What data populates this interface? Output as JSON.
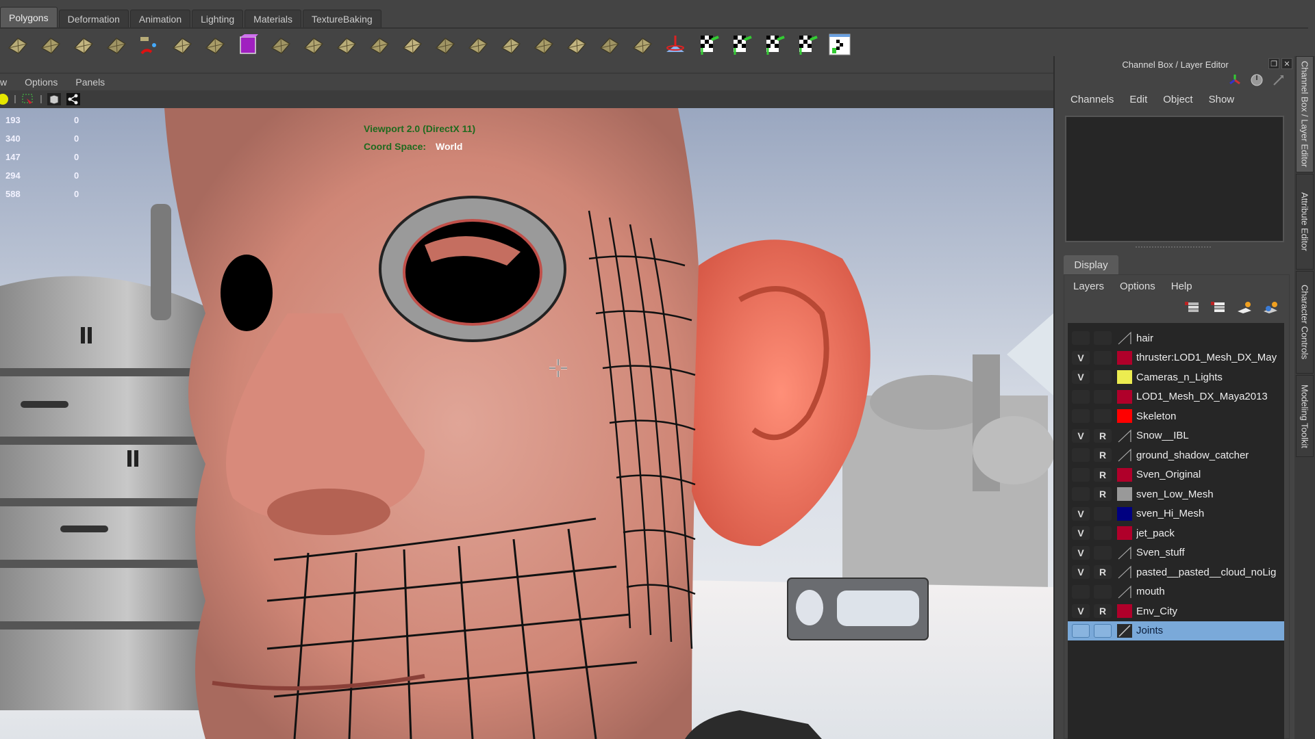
{
  "shelf": {
    "tabs": [
      {
        "label": "Polygons",
        "active": true
      },
      {
        "label": "Deformation",
        "active": false
      },
      {
        "label": "Animation",
        "active": false
      },
      {
        "label": "Lighting",
        "active": false
      },
      {
        "label": "Materials",
        "active": false
      },
      {
        "label": "TextureBaking",
        "active": false
      }
    ],
    "icons": [
      "poly-torus-icon",
      "poly-cone-icon",
      "poly-cylinder-icon",
      "poly-plane-icon",
      "separate-icon",
      "combine-icon",
      "smooth-icon",
      "bevel-cube-icon",
      "extrude-icon",
      "split-poly-icon",
      "bridge-icon",
      "append-icon",
      "fill-hole-icon",
      "duplicate-face-icon",
      "insert-edge-loop-icon",
      "offset-edge-loop-icon",
      "merge-icon",
      "collapse-icon",
      "wedge-icon",
      "poke-icon",
      "sculpt-icon",
      "uv-planar-icon",
      "uv-cylindrical-icon",
      "uv-spherical-icon",
      "uv-automatic-icon",
      "uv-editor-icon"
    ]
  },
  "panel": {
    "menu": [
      "w",
      "Options",
      "Panels"
    ],
    "toolbar_icons": [
      "light-icon",
      "select-camera-icon",
      "cube-icon",
      "share-icon"
    ]
  },
  "viewport": {
    "stats": [
      {
        "value": "193",
        "extra": "0"
      },
      {
        "value": "340",
        "extra": "0"
      },
      {
        "value": "147",
        "extra": "0"
      },
      {
        "value": "294",
        "extra": "0"
      },
      {
        "value": "588",
        "extra": "0"
      }
    ],
    "renderer": "Viewport 2.0 (DirectX 11)",
    "coord_label": "Coord Space:",
    "coord_value": "World"
  },
  "side_panel": {
    "title": "Channel Box / Layer Editor",
    "menu": [
      "Channels",
      "Edit",
      "Object",
      "Show"
    ],
    "display_tab": "Display",
    "layer_menu": [
      "Layers",
      "Options",
      "Help"
    ],
    "layer_icons": [
      "new-layer-selected-icon",
      "new-layer-icon",
      "new-anim-layer-icon",
      "new-render-layer-icon"
    ],
    "layers": [
      {
        "name": "hair",
        "v": "",
        "r": "",
        "color": null
      },
      {
        "name": "thruster:LOD1_Mesh_DX_May",
        "v": "V",
        "r": "",
        "color": "#b0002a"
      },
      {
        "name": "Cameras_n_Lights",
        "v": "V",
        "r": "",
        "color": "#ecec50"
      },
      {
        "name": "LOD1_Mesh_DX_Maya2013",
        "v": "",
        "r": "",
        "color": "#b0002a"
      },
      {
        "name": "Skeleton",
        "v": "",
        "r": "",
        "color": "#ff0000"
      },
      {
        "name": "Snow__IBL",
        "v": "V",
        "r": "R",
        "color": null
      },
      {
        "name": "ground_shadow_catcher",
        "v": "",
        "r": "R",
        "color": null
      },
      {
        "name": "Sven_Original",
        "v": "",
        "r": "R",
        "color": "#b0002a"
      },
      {
        "name": "sven_Low_Mesh",
        "v": "",
        "r": "R",
        "color": "#999999"
      },
      {
        "name": "sven_Hi_Mesh",
        "v": "V",
        "r": "",
        "color": "#000080"
      },
      {
        "name": "jet_pack",
        "v": "V",
        "r": "",
        "color": "#b0002a"
      },
      {
        "name": "Sven_stuff",
        "v": "V",
        "r": "",
        "color": null
      },
      {
        "name": "pasted__pasted__cloud_noLig",
        "v": "V",
        "r": "R",
        "color": null
      },
      {
        "name": "mouth",
        "v": "",
        "r": "",
        "color": null
      },
      {
        "name": "Env_City",
        "v": "V",
        "r": "R",
        "color": "#b0002a"
      },
      {
        "name": "Joints",
        "v": "",
        "r": "",
        "color": "dark",
        "selected": true
      }
    ]
  },
  "vertical_tabs": [
    {
      "label": "Channel Box / Layer Editor",
      "active": true
    },
    {
      "label": "Attribute Editor",
      "active": false
    },
    {
      "label": "Character Controls",
      "active": false
    },
    {
      "label": "Modeling Toolkit",
      "active": false
    }
  ]
}
